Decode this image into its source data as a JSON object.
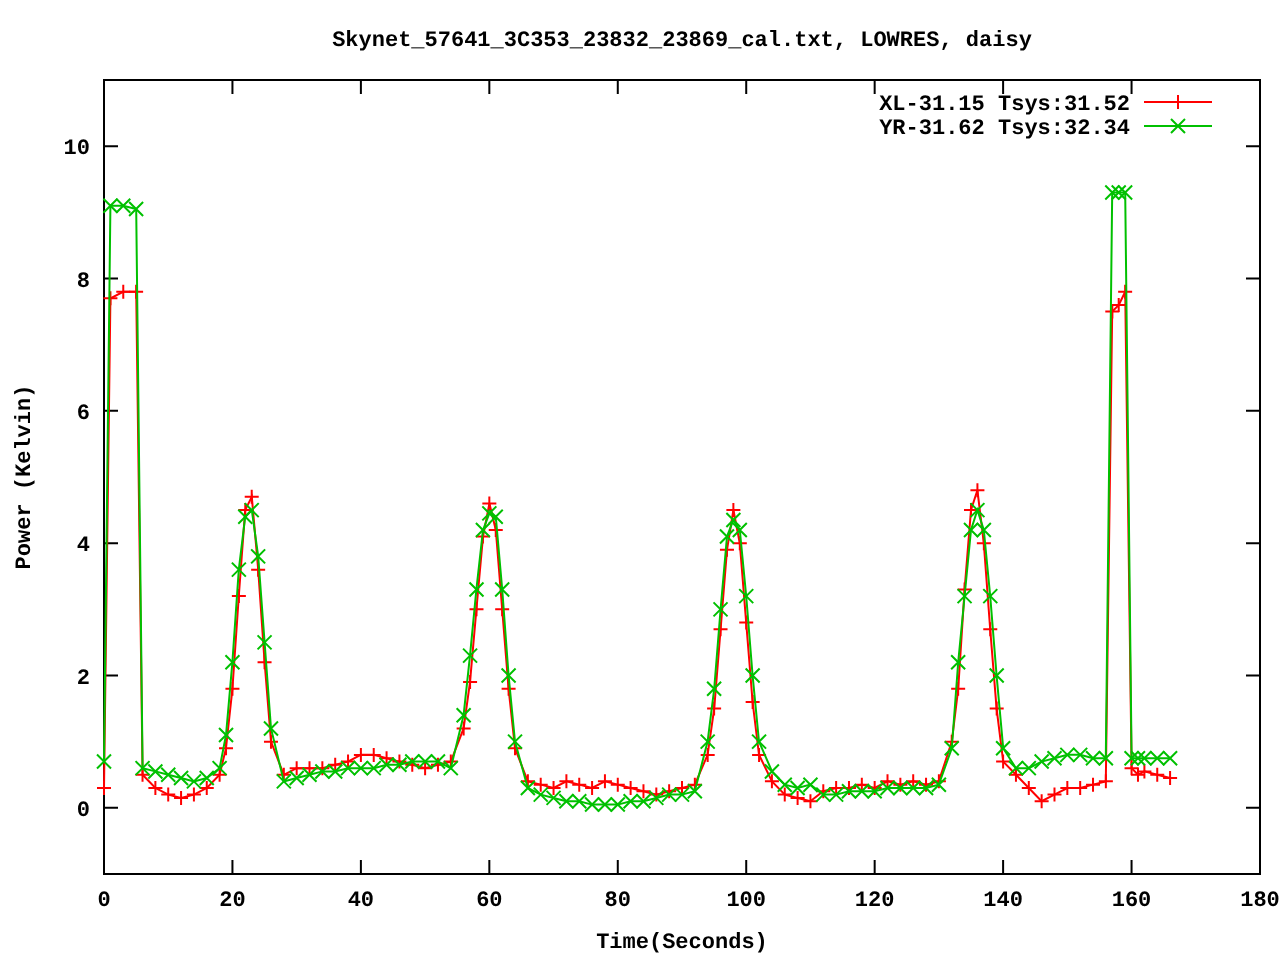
{
  "chart_data": {
    "type": "line",
    "title": "Skynet_57641_3C353_23832_23869_cal.txt, LOWRES, daisy",
    "xlabel": "Time(Seconds)",
    "ylabel": "Power (Kelvin)",
    "xlim": [
      0,
      180
    ],
    "ylim": [
      -1,
      11
    ],
    "xticks": [
      0,
      20,
      40,
      60,
      80,
      100,
      120,
      140,
      160,
      180
    ],
    "yticks": [
      0,
      2,
      4,
      6,
      8,
      10
    ],
    "legend": true,
    "x": [
      0,
      1,
      3,
      5,
      6,
      8,
      10,
      12,
      14,
      16,
      18,
      19,
      20,
      21,
      22,
      23,
      24,
      25,
      26,
      28,
      30,
      32,
      34,
      36,
      38,
      40,
      42,
      44,
      46,
      48,
      50,
      52,
      54,
      56,
      57,
      58,
      59,
      60,
      61,
      62,
      63,
      64,
      66,
      68,
      70,
      72,
      74,
      76,
      78,
      80,
      82,
      84,
      86,
      88,
      90,
      92,
      94,
      95,
      96,
      97,
      98,
      99,
      100,
      101,
      102,
      104,
      106,
      108,
      110,
      112,
      114,
      116,
      118,
      120,
      122,
      124,
      126,
      128,
      130,
      132,
      133,
      134,
      135,
      136,
      137,
      138,
      139,
      140,
      142,
      144,
      146,
      148,
      150,
      152,
      154,
      156,
      157,
      158,
      159,
      160,
      161,
      162,
      164,
      166
    ],
    "series": [
      {
        "name": "XL-31.15 Tsys:31.52",
        "color": "#ff0000",
        "marker": "+",
        "values": [
          0.3,
          7.7,
          7.8,
          7.8,
          0.5,
          0.3,
          0.2,
          0.15,
          0.2,
          0.3,
          0.5,
          0.9,
          1.8,
          3.2,
          4.5,
          4.7,
          3.6,
          2.2,
          1.0,
          0.5,
          0.6,
          0.6,
          0.6,
          0.65,
          0.7,
          0.8,
          0.8,
          0.75,
          0.7,
          0.65,
          0.6,
          0.65,
          0.7,
          1.2,
          1.9,
          3.0,
          4.1,
          4.6,
          4.2,
          3.0,
          1.8,
          0.9,
          0.4,
          0.35,
          0.3,
          0.4,
          0.35,
          0.3,
          0.4,
          0.35,
          0.3,
          0.25,
          0.2,
          0.25,
          0.3,
          0.35,
          0.8,
          1.5,
          2.7,
          3.9,
          4.5,
          4.0,
          2.8,
          1.6,
          0.8,
          0.4,
          0.2,
          0.15,
          0.1,
          0.25,
          0.3,
          0.3,
          0.35,
          0.3,
          0.4,
          0.35,
          0.4,
          0.35,
          0.4,
          1.0,
          1.8,
          3.3,
          4.5,
          4.8,
          4.0,
          2.7,
          1.5,
          0.7,
          0.5,
          0.3,
          0.1,
          0.2,
          0.3,
          0.3,
          0.35,
          0.4,
          7.5,
          7.6,
          7.8,
          0.6,
          0.5,
          0.55,
          0.5,
          0.45
        ]
      },
      {
        "name": "YR-31.62 Tsys:32.34",
        "color": "#00c000",
        "marker": "x",
        "values": [
          0.7,
          9.1,
          9.1,
          9.05,
          0.6,
          0.55,
          0.5,
          0.45,
          0.4,
          0.45,
          0.6,
          1.1,
          2.2,
          3.6,
          4.4,
          4.5,
          3.8,
          2.5,
          1.2,
          0.4,
          0.45,
          0.5,
          0.55,
          0.55,
          0.6,
          0.6,
          0.6,
          0.65,
          0.65,
          0.7,
          0.7,
          0.7,
          0.6,
          1.4,
          2.3,
          3.3,
          4.2,
          4.45,
          4.4,
          3.3,
          2.0,
          1.0,
          0.3,
          0.2,
          0.15,
          0.1,
          0.1,
          0.05,
          0.05,
          0.05,
          0.1,
          0.1,
          0.15,
          0.2,
          0.2,
          0.25,
          1.0,
          1.8,
          3.0,
          4.1,
          4.35,
          4.2,
          3.2,
          2.0,
          1.0,
          0.55,
          0.35,
          0.3,
          0.35,
          0.2,
          0.2,
          0.25,
          0.25,
          0.25,
          0.3,
          0.3,
          0.3,
          0.3,
          0.35,
          0.9,
          2.2,
          3.2,
          4.2,
          4.5,
          4.2,
          3.2,
          2.0,
          0.9,
          0.6,
          0.6,
          0.7,
          0.75,
          0.8,
          0.8,
          0.75,
          0.75,
          9.3,
          9.3,
          9.3,
          0.75,
          0.75,
          0.75,
          0.75,
          0.75
        ]
      }
    ]
  }
}
